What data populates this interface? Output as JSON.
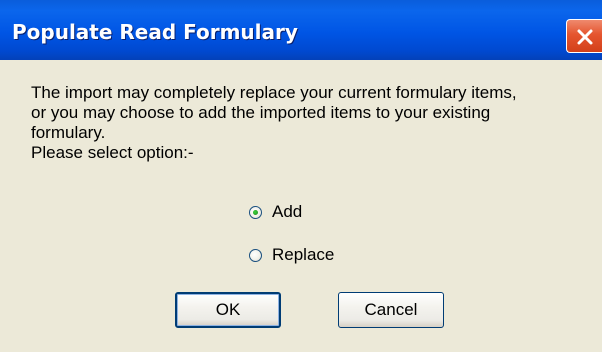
{
  "window": {
    "title": "Populate Read Formulary"
  },
  "message": {
    "lines": [
      "The import may completely replace your current formulary items,",
      "or you may choose to add the imported items to your existing",
      "formulary.",
      "Please select option:-"
    ]
  },
  "options": [
    {
      "label": "Add",
      "selected": true
    },
    {
      "label": "Replace",
      "selected": false
    }
  ],
  "buttons": {
    "ok_label": "OK",
    "cancel_label": "Cancel"
  },
  "icons": {
    "close": "close-icon",
    "radio": "radio-button"
  },
  "colors": {
    "titlebar": "#0055e5",
    "dialog_background": "#ece9d8",
    "close_button": "#e5552f",
    "radio_selected": "#21a121"
  }
}
